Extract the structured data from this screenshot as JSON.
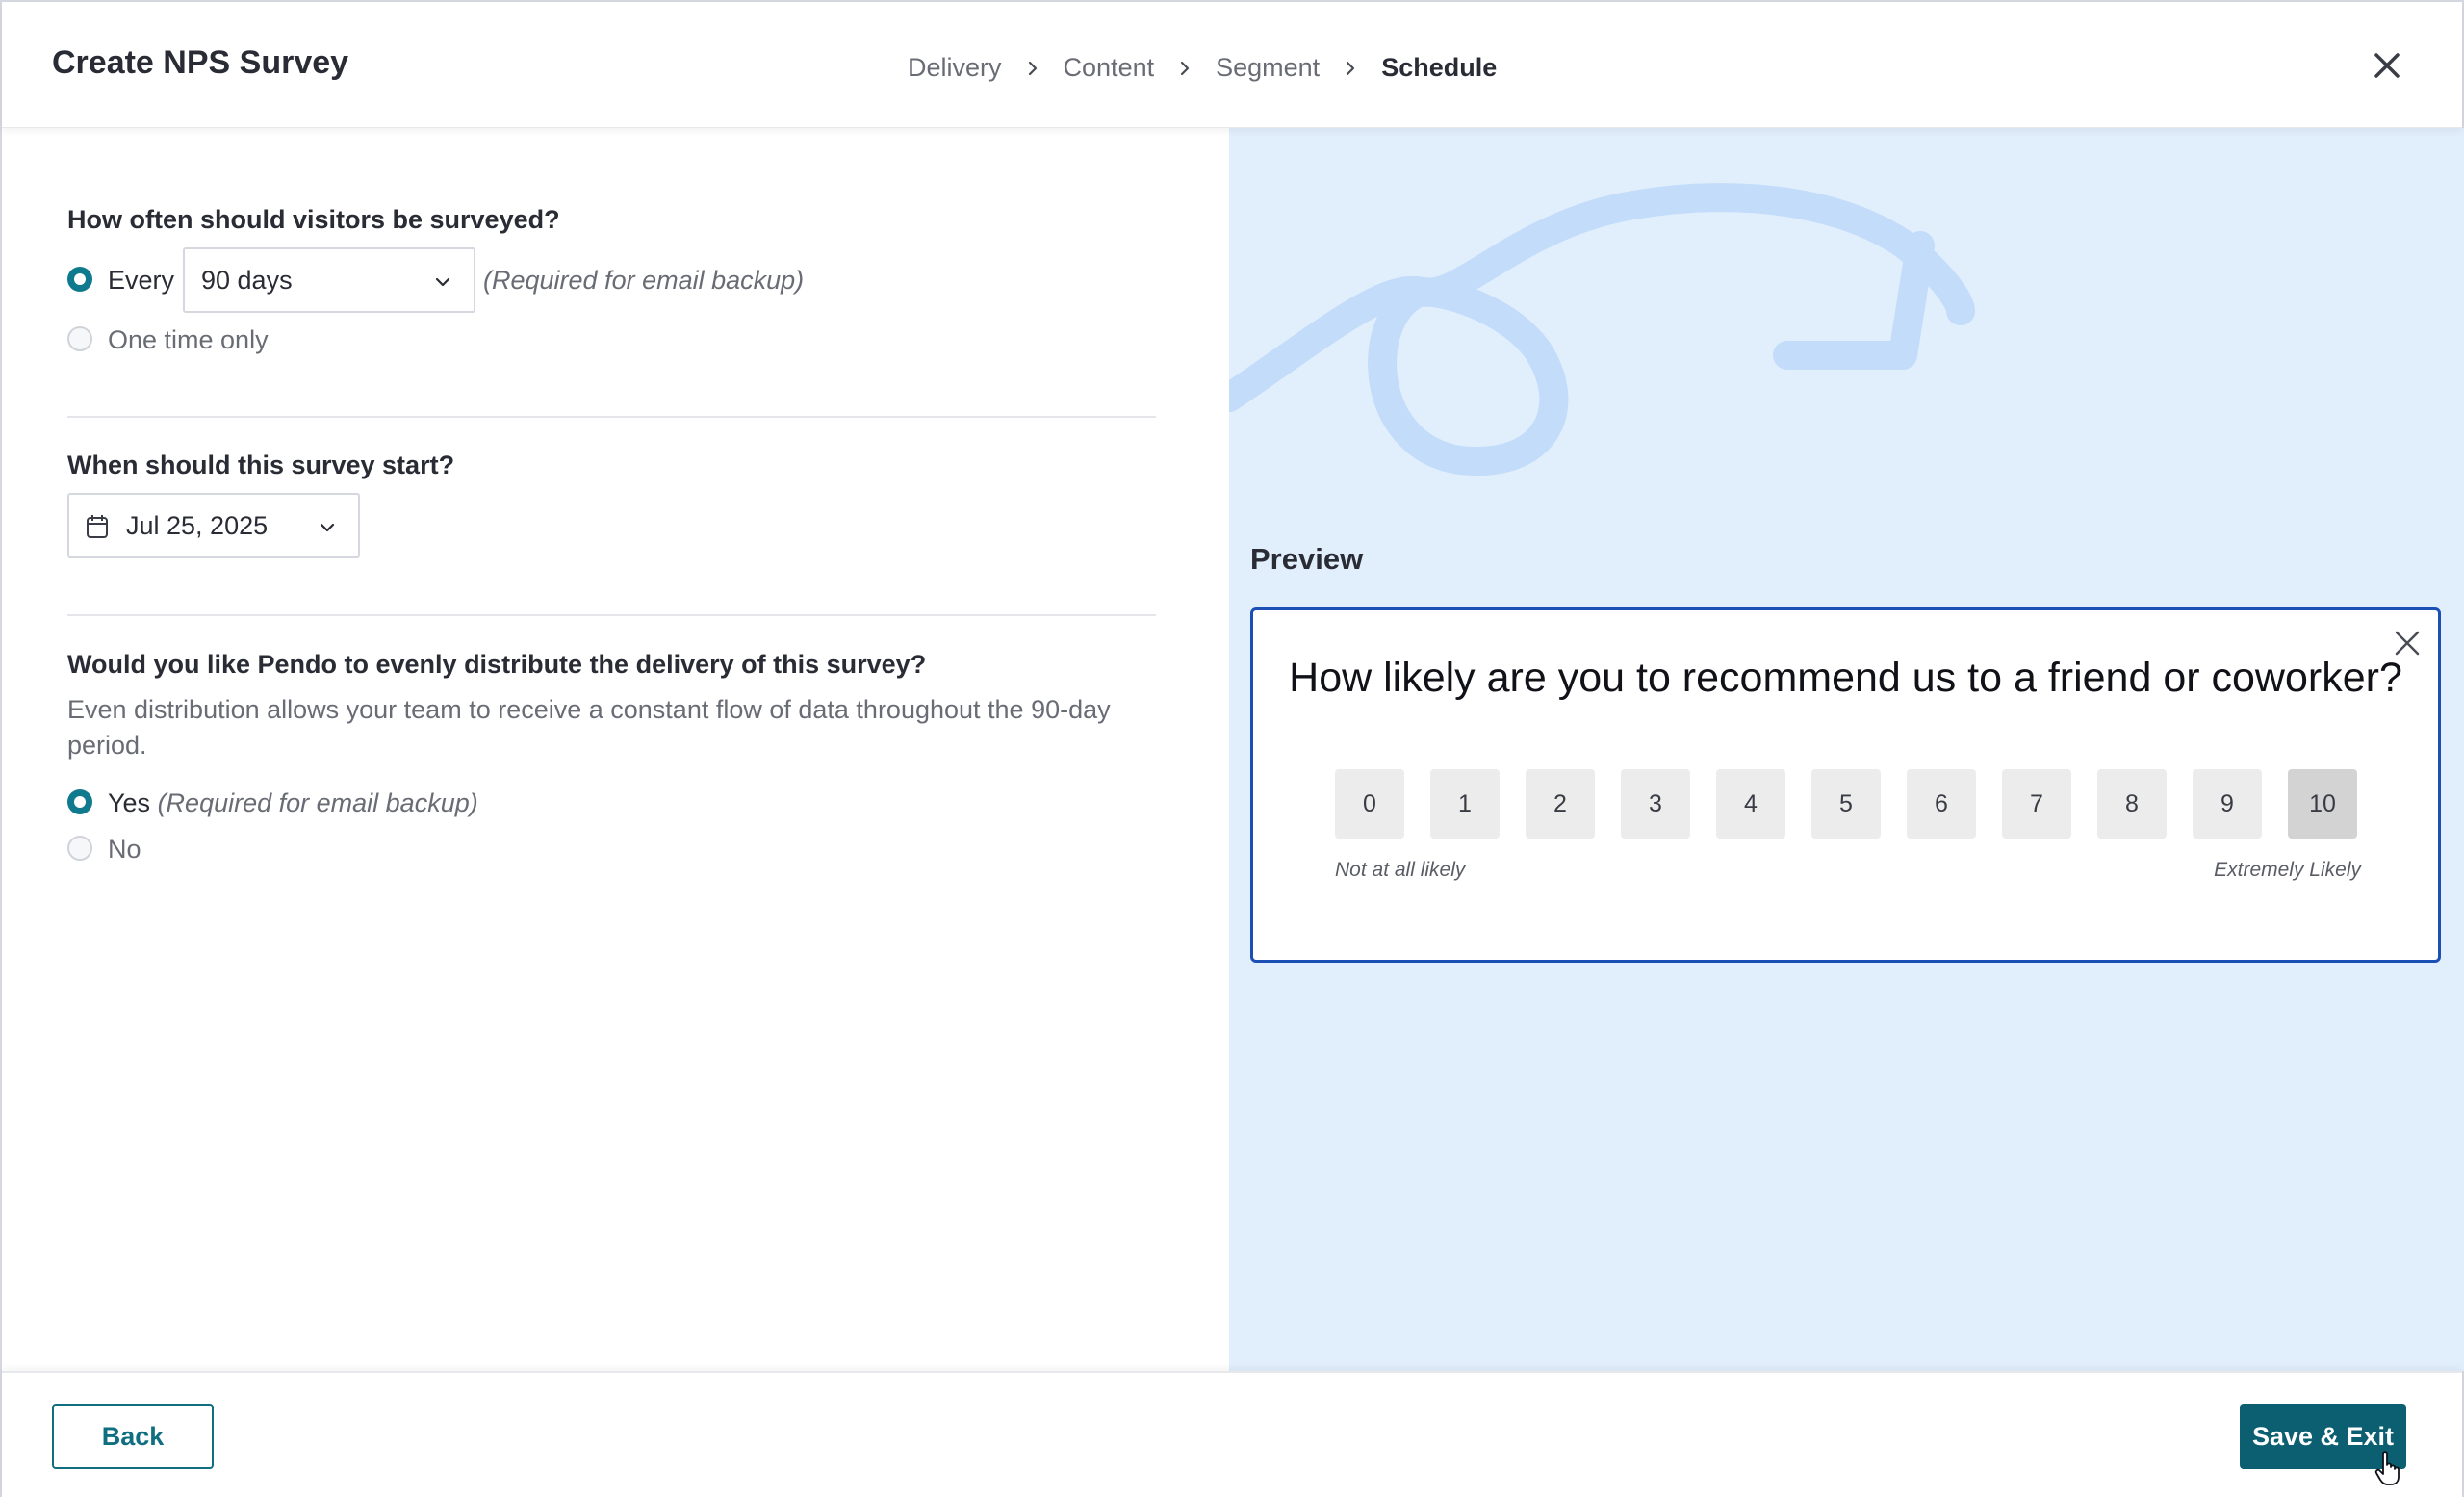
{
  "header": {
    "title": "Create NPS Survey",
    "steps": [
      "Delivery",
      "Content",
      "Segment",
      "Schedule"
    ],
    "active_step": "Schedule"
  },
  "frequency": {
    "question": "How often should visitors be surveyed?",
    "every_label": "Every",
    "interval_value": "90 days",
    "every_note": "(Required for email backup)",
    "one_time_label": "One time only",
    "selected": "every"
  },
  "start": {
    "question": "When should this survey start?",
    "date_value": "Jul 25, 2025"
  },
  "distribution": {
    "question": "Would you like Pendo to evenly distribute the delivery of this survey?",
    "description": "Even distribution allows your team to receive a constant flow of data throughout the 90-day period.",
    "yes_label": "Yes",
    "yes_note": "(Required for email backup)",
    "no_label": "No",
    "selected": "yes"
  },
  "preview": {
    "label": "Preview",
    "question": "How likely are you to recommend us to a friend or coworker?",
    "scale": [
      "0",
      "1",
      "2",
      "3",
      "4",
      "5",
      "6",
      "7",
      "8",
      "9",
      "10"
    ],
    "low_label": "Not at all likely",
    "high_label": "Extremely Likely"
  },
  "footer": {
    "back_label": "Back",
    "save_label": "Save & Exit"
  },
  "colors": {
    "accent": "#0f7a8d",
    "primary_button": "#0b5f70",
    "preview_bg": "#e1eefc",
    "preview_border": "#1c4fb6",
    "doodle": "#c2dcfa"
  }
}
